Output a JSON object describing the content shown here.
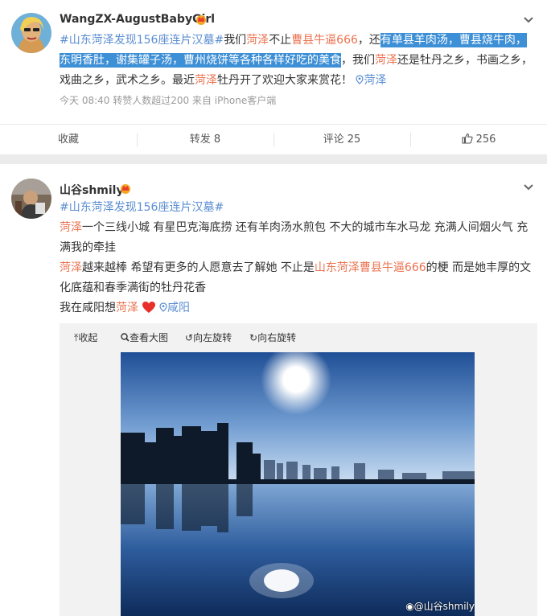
{
  "post1": {
    "username": "WangZX-AugustBabyGirl",
    "text": {
      "topic": "#山东菏泽发现156座连片汉墓#",
      "t1": "我们",
      "link1": "菏泽",
      "t2": "不止",
      "link2": "曹县牛逼666",
      "t3": "，还",
      "hl1": "有单县羊肉汤，曹县烧牛肉，",
      "hl2": "东明香肚，谢集罐子汤，曹州烧饼等各种各样好吃的美食",
      "t4": "，我们",
      "link3": "菏泽",
      "t5": "还是牡丹之乡，书画之乡，戏曲之乡，武术之乡。最近",
      "link4": "菏泽",
      "t6": "牡丹开了欢迎大家来赏花！",
      "location": "菏泽"
    },
    "meta": "今天 08:40 转赞人数超过200   来自 iPhone客户端",
    "actions": {
      "collect": "收藏",
      "repost": "转发 8",
      "comment": "评论 25",
      "like": "256"
    }
  },
  "post2": {
    "username": "山谷shmily",
    "text": {
      "topic": "#山东菏泽发现156座连片汉墓#",
      "p1_link": "菏泽",
      "p1_text": "一个三线小城 有星巴克海底捞 还有羊肉汤水煎包 不大的城市车水马龙 充满人间烟火气 充满我的牵挂",
      "p2_link": "菏泽",
      "p2_text1": "越来越棒 希望有更多的人愿意去了解她 不止是",
      "p2_link2": "山东菏泽曹县牛逼666",
      "p2_text2": "的梗 而是她丰厚的文化底蕴和春季满街的牡丹花香",
      "p3_text": "我在咸阳想",
      "p3_link": "菏泽",
      "location": "咸阳"
    },
    "media_tools": {
      "collapse": "收起",
      "view_large": "查看大图",
      "rotate_left": "向左旋转",
      "rotate_right": "向右旋转"
    },
    "watermark": "@山谷shmily"
  },
  "colors": {
    "link": "#eb7350",
    "topic": "#5b8ed1",
    "highlight": "#3d8fd6"
  },
  "icons": [
    "crown-icon",
    "chevron-down-icon",
    "location-icon",
    "thumb-up-icon",
    "heart-icon",
    "weibo-icon",
    "zoom-icon",
    "rotate-left-icon",
    "rotate-right-icon",
    "collapse-icon"
  ]
}
